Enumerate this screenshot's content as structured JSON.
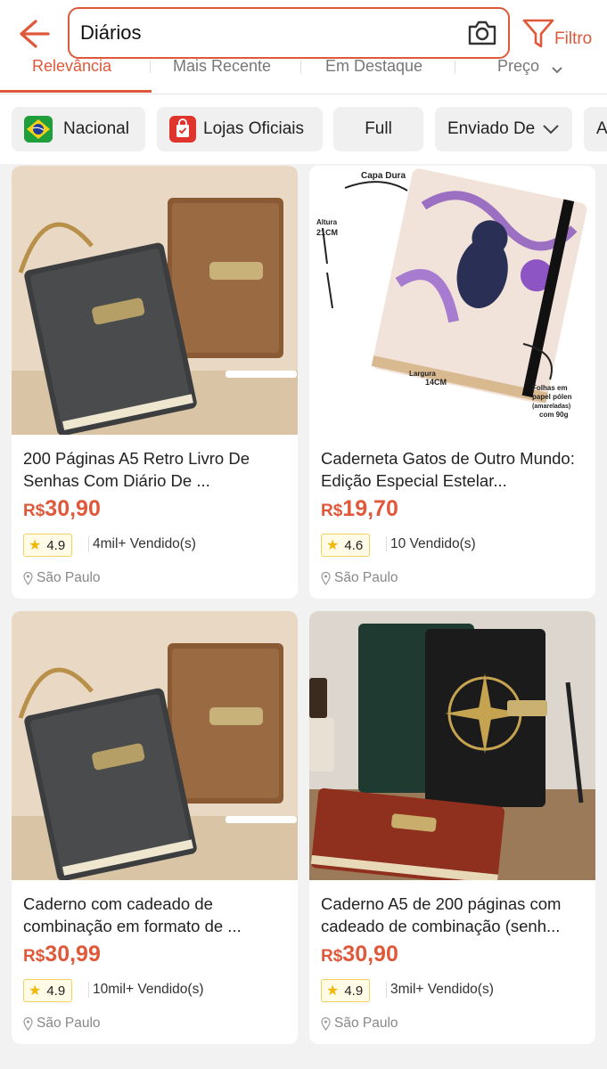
{
  "header": {
    "search_query": "Diários",
    "filter_label": "Filtro"
  },
  "sort_tabs": [
    "Relevância",
    "Mais Recente",
    "Em Destaque",
    "Preço"
  ],
  "chips": {
    "national": "Nacional",
    "official": "Lojas Oficiais",
    "full": "Full",
    "shipped_from": "Enviado De",
    "partial": "A"
  },
  "colors": {
    "accent": "#e0583a",
    "star": "#f2b705"
  },
  "products": [
    {
      "title": "200 Páginas A5 Retro Livro De Senhas Com Diário De ...",
      "currency": "R$",
      "price": "30,90",
      "rating": "4.9",
      "sold": "4mil+ Vendido(s)",
      "location": "São Paulo",
      "image": "leather-notebooks-with-lock"
    },
    {
      "title": "Caderneta Gatos de Outro Mundo: Edição Especial Estelar...",
      "currency": "R$",
      "price": "19,70",
      "rating": "4.6",
      "sold": "10 Vendido(s)",
      "location": "São Paulo",
      "image": "cat-witch-notebook",
      "image_labels": {
        "cover": "Capa Dura",
        "height": "Altura",
        "height_val": "21CM",
        "width": "Largura",
        "width_val": "14CM",
        "pages_1": "Folhas em",
        "pages_2": "papel pólen",
        "pages_3": "(amareladas)",
        "pages_4": "com 90g"
      }
    },
    {
      "title": "Caderno com cadeado de combinação em formato de ...",
      "currency": "R$",
      "price": "30,99",
      "rating": "4.9",
      "sold": "10mil+ Vendido(s)",
      "location": "São Paulo",
      "image": "leather-notebooks-with-lock"
    },
    {
      "title": "Caderno A5 de 200 páginas com cadeado de combinação (senh...",
      "currency": "R$",
      "price": "30,90",
      "rating": "4.9",
      "sold": "3mil+ Vendido(s)",
      "location": "São Paulo",
      "image": "compass-notebooks"
    }
  ]
}
